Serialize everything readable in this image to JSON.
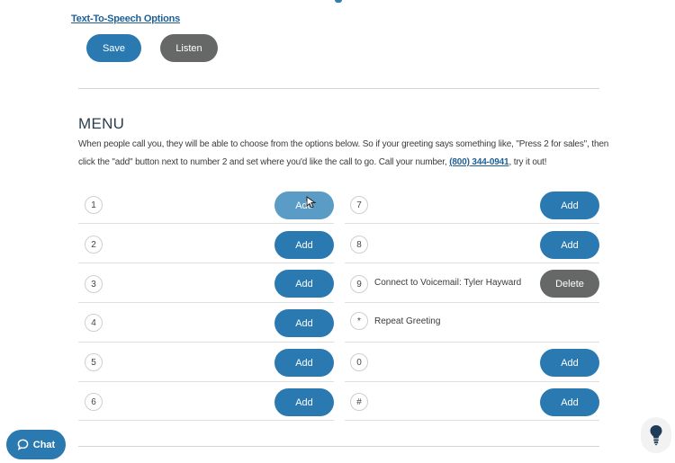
{
  "tts": {
    "link_label": "Text-To-Speech Options"
  },
  "actions": {
    "save_label": "Save",
    "listen_label": "Listen"
  },
  "menu": {
    "title": "MENU",
    "description_before_phone": "When people call you, they will be able to choose from the options below. So if your greeting says something like, \"Press 2 for sales\", then click the \"add\" button next to number 2 and set where you'd like the call to go. Call your number, ",
    "phone": "(800) 344-0941",
    "description_after_phone": ", try it out!"
  },
  "left_options": [
    {
      "key": "1",
      "button": "Add"
    },
    {
      "key": "2",
      "button": "Add"
    },
    {
      "key": "3",
      "button": "Add"
    },
    {
      "key": "4",
      "button": "Add"
    },
    {
      "key": "5",
      "button": "Add"
    },
    {
      "key": "6",
      "button": "Add"
    }
  ],
  "right_options": [
    {
      "key": "7",
      "label": "",
      "button": "Add"
    },
    {
      "key": "8",
      "label": "",
      "button": "Add"
    },
    {
      "key": "9",
      "label": "Connect to Voicemail: Tyler Hayward",
      "button": "Delete"
    },
    {
      "key": "*",
      "label": "Repeat Greeting",
      "button": ""
    },
    {
      "key": "0",
      "label": "",
      "button": "Add"
    },
    {
      "key": "#",
      "label": "",
      "button": "Add"
    }
  ],
  "chat": {
    "label": "Chat",
    "icon": "chat-bubble-icon"
  },
  "help": {
    "icon": "lightbulb-icon"
  },
  "colors": {
    "accent": "#2a79b0",
    "gray_button": "#666767",
    "link": "#1f5f94"
  }
}
